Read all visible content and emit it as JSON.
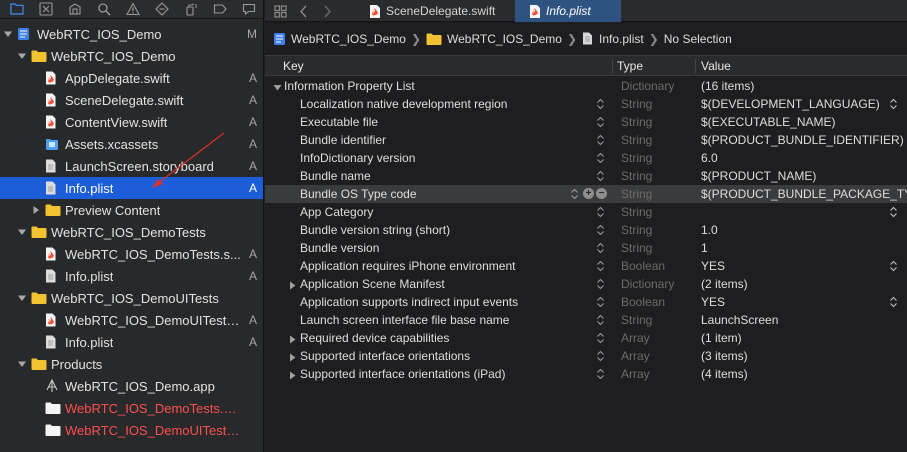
{
  "navigator": {
    "toolbar_icons": [
      "folder-icon",
      "source-control-icon",
      "symbol-icon",
      "find-icon",
      "issue-warning-icon",
      "test-diamond-icon",
      "debug-spray-icon",
      "breakpoint-icon",
      "report-icon"
    ],
    "rows": [
      {
        "label": "WebRTC_IOS_Demo",
        "icon": "project",
        "indent": 0,
        "disclosure": "open",
        "badge": "M",
        "selected": false,
        "red": false
      },
      {
        "label": "WebRTC_IOS_Demo",
        "icon": "folder",
        "indent": 1,
        "disclosure": "open",
        "badge": "",
        "selected": false,
        "red": false
      },
      {
        "label": "AppDelegate.swift",
        "icon": "swift",
        "indent": 2,
        "disclosure": "",
        "badge": "A",
        "selected": false,
        "red": false
      },
      {
        "label": "SceneDelegate.swift",
        "icon": "swift",
        "indent": 2,
        "disclosure": "",
        "badge": "A",
        "selected": false,
        "red": false
      },
      {
        "label": "ContentView.swift",
        "icon": "swift",
        "indent": 2,
        "disclosure": "",
        "badge": "A",
        "selected": false,
        "red": false
      },
      {
        "label": "Assets.xcassets",
        "icon": "assets",
        "indent": 2,
        "disclosure": "",
        "badge": "A",
        "selected": false,
        "red": false
      },
      {
        "label": "LaunchScreen.storyboard",
        "icon": "doc",
        "indent": 2,
        "disclosure": "",
        "badge": "A",
        "selected": false,
        "red": false
      },
      {
        "label": "Info.plist",
        "icon": "doc",
        "indent": 2,
        "disclosure": "",
        "badge": "A",
        "selected": true,
        "red": false
      },
      {
        "label": "Preview Content",
        "icon": "folder",
        "indent": 2,
        "disclosure": "closed",
        "badge": "",
        "selected": false,
        "red": false
      },
      {
        "label": "WebRTC_IOS_DemoTests",
        "icon": "folder",
        "indent": 1,
        "disclosure": "open",
        "badge": "",
        "selected": false,
        "red": false
      },
      {
        "label": "WebRTC_IOS_DemoTests.s...",
        "icon": "swift",
        "indent": 2,
        "disclosure": "",
        "badge": "A",
        "selected": false,
        "red": false
      },
      {
        "label": "Info.plist",
        "icon": "doc",
        "indent": 2,
        "disclosure": "",
        "badge": "A",
        "selected": false,
        "red": false
      },
      {
        "label": "WebRTC_IOS_DemoUITests",
        "icon": "folder",
        "indent": 1,
        "disclosure": "open",
        "badge": "",
        "selected": false,
        "red": false
      },
      {
        "label": "WebRTC_IOS_DemoUITests....",
        "icon": "swift",
        "indent": 2,
        "disclosure": "",
        "badge": "A",
        "selected": false,
        "red": false
      },
      {
        "label": "Info.plist",
        "icon": "doc",
        "indent": 2,
        "disclosure": "",
        "badge": "A",
        "selected": false,
        "red": false
      },
      {
        "label": "Products",
        "icon": "folder",
        "indent": 1,
        "disclosure": "open",
        "badge": "",
        "selected": false,
        "red": false
      },
      {
        "label": "WebRTC_IOS_Demo.app",
        "icon": "app",
        "indent": 2,
        "disclosure": "",
        "badge": "",
        "selected": false,
        "red": false
      },
      {
        "label": "WebRTC_IOS_DemoTests.xctest",
        "icon": "bundle",
        "indent": 2,
        "disclosure": "",
        "badge": "",
        "selected": false,
        "red": true
      },
      {
        "label": "WebRTC_IOS_DemoUITests.xct...",
        "icon": "bundle",
        "indent": 2,
        "disclosure": "",
        "badge": "",
        "selected": false,
        "red": true
      }
    ]
  },
  "tabs": [
    {
      "label": "SceneDelegate.swift",
      "active": false
    },
    {
      "label": "Info.plist",
      "active": true
    }
  ],
  "jumpbar": [
    "WebRTC_IOS_Demo",
    "WebRTC_IOS_Demo",
    "Info.plist",
    "No Selection"
  ],
  "plist": {
    "headers": {
      "key": "Key",
      "type": "Type",
      "value": "Value"
    },
    "rows": [
      {
        "key": "Information Property List",
        "type": "Dictionary",
        "value": "(16 items)",
        "level": 0,
        "disclosure": "open",
        "stepper": false,
        "value_popup": false,
        "highlight": false
      },
      {
        "key": "Localization native development region",
        "type": "String",
        "value": "$(DEVELOPMENT_LANGUAGE)",
        "level": 1,
        "disclosure": "",
        "stepper": true,
        "value_popup": true,
        "highlight": false
      },
      {
        "key": "Executable file",
        "type": "String",
        "value": "$(EXECUTABLE_NAME)",
        "level": 1,
        "disclosure": "",
        "stepper": true,
        "value_popup": false,
        "highlight": false
      },
      {
        "key": "Bundle identifier",
        "type": "String",
        "value": "$(PRODUCT_BUNDLE_IDENTIFIER)",
        "level": 1,
        "disclosure": "",
        "stepper": true,
        "value_popup": false,
        "highlight": false
      },
      {
        "key": "InfoDictionary version",
        "type": "String",
        "value": "6.0",
        "level": 1,
        "disclosure": "",
        "stepper": true,
        "value_popup": false,
        "highlight": false
      },
      {
        "key": "Bundle name",
        "type": "String",
        "value": "$(PRODUCT_NAME)",
        "level": 1,
        "disclosure": "",
        "stepper": true,
        "value_popup": false,
        "highlight": false
      },
      {
        "key": "Bundle OS Type code",
        "type": "String",
        "value": "$(PRODUCT_BUNDLE_PACKAGE_TYPE)",
        "level": 1,
        "disclosure": "",
        "stepper": true,
        "value_popup": false,
        "highlight": true
      },
      {
        "key": "App Category",
        "type": "String",
        "value": "",
        "level": 1,
        "disclosure": "",
        "stepper": true,
        "value_popup": true,
        "highlight": false
      },
      {
        "key": "Bundle version string (short)",
        "type": "String",
        "value": "1.0",
        "level": 1,
        "disclosure": "",
        "stepper": true,
        "value_popup": false,
        "highlight": false
      },
      {
        "key": "Bundle version",
        "type": "String",
        "value": "1",
        "level": 1,
        "disclosure": "",
        "stepper": true,
        "value_popup": false,
        "highlight": false
      },
      {
        "key": "Application requires iPhone environment",
        "type": "Boolean",
        "value": "YES",
        "level": 1,
        "disclosure": "",
        "stepper": true,
        "value_popup": true,
        "highlight": false
      },
      {
        "key": "Application Scene Manifest",
        "type": "Dictionary",
        "value": "(2 items)",
        "level": 1,
        "disclosure": "closed",
        "stepper": true,
        "value_popup": false,
        "highlight": false
      },
      {
        "key": "Application supports indirect input events",
        "type": "Boolean",
        "value": "YES",
        "level": 1,
        "disclosure": "",
        "stepper": true,
        "value_popup": true,
        "highlight": false
      },
      {
        "key": "Launch screen interface file base name",
        "type": "String",
        "value": "LaunchScreen",
        "level": 1,
        "disclosure": "",
        "stepper": true,
        "value_popup": false,
        "highlight": false
      },
      {
        "key": "Required device capabilities",
        "type": "Array",
        "value": "(1 item)",
        "level": 1,
        "disclosure": "closed",
        "stepper": true,
        "value_popup": false,
        "highlight": false
      },
      {
        "key": "Supported interface orientations",
        "type": "Array",
        "value": "(3 items)",
        "level": 1,
        "disclosure": "closed",
        "stepper": true,
        "value_popup": false,
        "highlight": false
      },
      {
        "key": "Supported interface orientations (iPad)",
        "type": "Array",
        "value": "(4 items)",
        "level": 1,
        "disclosure": "closed",
        "stepper": true,
        "value_popup": false,
        "highlight": false
      }
    ]
  },
  "colors": {
    "selection": "#1c5ed9",
    "active_tab": "#2e5381",
    "missing_product": "#ff4f4f",
    "folder": "#f2c230",
    "swift": "#f05138"
  }
}
